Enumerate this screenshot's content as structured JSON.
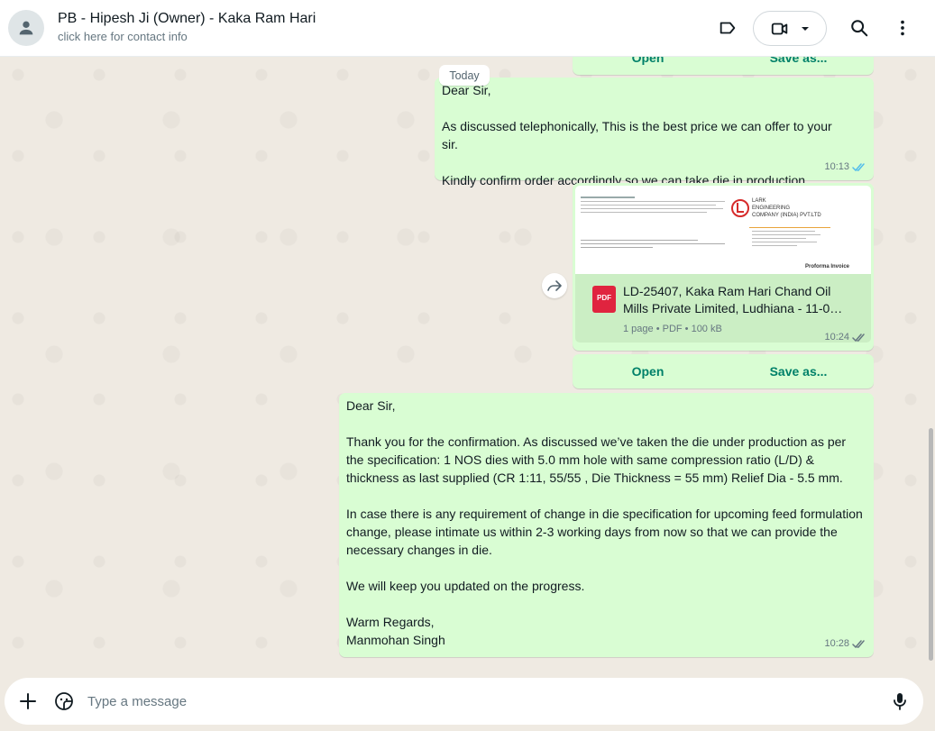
{
  "header": {
    "title": "PB - Hipesh Ji (Owner) - Kaka Ram Hari",
    "subtitle": "click here for contact info"
  },
  "chat": {
    "date_chip": "Today",
    "top_actions": {
      "open": "Open",
      "save": "Save as..."
    },
    "message1": {
      "text": "Dear Sir,\n\nAs discussed telephonically, This is the best price we can offer to your sir.\n\nKindly confirm order accordingly so we can take die in production.",
      "time": "10:13"
    },
    "document": {
      "preview_company": "LARK\nENGINEERING\nCOMPANY (INDIA) PVT.LTD",
      "preview_heading": "Proforma Invoice",
      "badge": "PDF",
      "name": "LD-25407, Kaka Ram Hari Chand Oil Mills Private Limited, Ludhiana - 11-0…",
      "info": "1 page • PDF • 100 kB",
      "time": "10:24",
      "open_label": "Open",
      "save_label": "Save as..."
    },
    "message2": {
      "text": "Dear Sir,\n\nThank you for the confirmation. As discussed we’ve taken the die under production as per the specification: 1 NOS dies with 5.0 mm hole with same compression ratio (L/D) & thickness as last supplied (CR 1:11, 55/55 , Die Thickness = 55 mm) Relief Dia - 5.5 mm.\n\nIn case there is any requirement of change in die specification for upcoming feed formulation change, please intimate us within 2-3 working days from now so that we can provide the necessary changes in die.\n\nWe will keep you updated on the progress.\n\nWarm Regards,\nManmohan Singh",
      "time": "10:28"
    }
  },
  "composer": {
    "placeholder": "Type a message"
  },
  "colors": {
    "outgoing_bubble": "#d9fdd3",
    "accent": "#008069",
    "read_ticks": "#53bdeb",
    "pdf_red": "#e0243f"
  },
  "icons": [
    "user-icon",
    "label-icon",
    "video-icon",
    "chevron-down-icon",
    "search-icon",
    "menu-icon",
    "forward-icon",
    "double-check-icon",
    "plus-icon",
    "sticker-icon",
    "mic-icon"
  ]
}
